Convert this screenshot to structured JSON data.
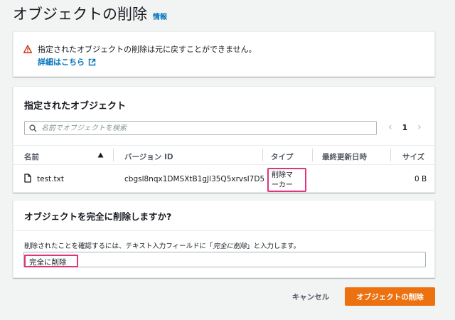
{
  "header": {
    "title": "オブジェクトの削除",
    "info_link": "情報"
  },
  "alert": {
    "message": "指定されたオブジェクトの削除は元に戻すことができません。",
    "link_text": "詳細はこちら",
    "icon": "warning-icon",
    "icon_color": "#d13212"
  },
  "objects": {
    "title": "指定されたオブジェクト",
    "search_placeholder": "名前でオブジェクトを検索",
    "pager": {
      "prev": "‹",
      "page": "1",
      "next": "›"
    },
    "columns": {
      "name": "名前",
      "version": "バージョン ID",
      "type": "タイプ",
      "modified": "最終更新日時",
      "size": "サイズ"
    },
    "rows": [
      {
        "name": "test.txt",
        "version": "cbgsl8nqx1DMSXtB1gJl35Q5xrvsI7D5",
        "type_line1": "削除マ",
        "type_line2": "ーカー",
        "modified": "",
        "size": "0 B"
      }
    ]
  },
  "confirm": {
    "title": "オブジェクトを完全に削除しますか?",
    "description_pre": "削除されたことを確認するには、テキスト入力フィールドに「",
    "description_phrase": "完全に削除",
    "description_post": "」と入力します。",
    "input_value": "完全に削除"
  },
  "actions": {
    "cancel_label": "キャンセル",
    "delete_label": "オブジェクトの削除"
  },
  "colors": {
    "accent": "#ec7211",
    "link": "#0073bb",
    "highlight": "#e0347b"
  }
}
